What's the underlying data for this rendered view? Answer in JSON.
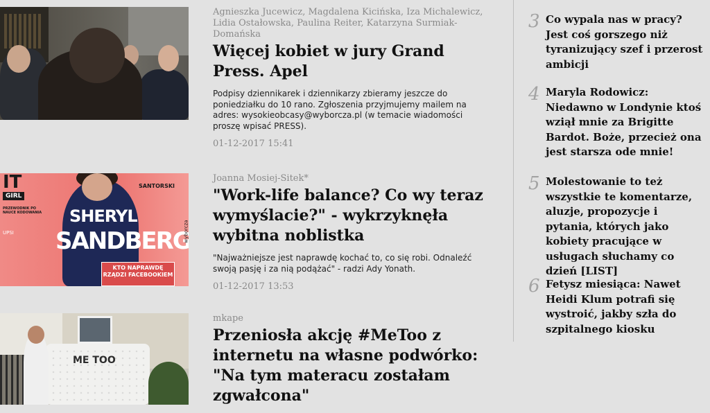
{
  "articles": [
    {
      "authors": "Agnieszka Jucewicz, Magdalena Kicińska, Iza Michalewicz, Lidia Ostałowska, Paulina Reiter, Katarzyna Surmiak-Domańska",
      "title": "Więcej kobiet w jury Grand Press. Apel",
      "lead": "Podpisy dziennikarek i dziennikarzy zbieramy jeszcze do poniedziałku do 10 rano. Zgłoszenia przyjmujemy mailem na adres: wysokieobcasy@wyborcza.pl (w temacie wiadomości proszę wpisać PRESS).",
      "date": "01-12-2017 15:41"
    },
    {
      "authors": "Joanna Mosiej-Sitek*",
      "title": "\"Work-life balance? Co wy teraz wymyślacie?\" - wykrzyknęła wybitna noblistka",
      "lead": "\"Najważniejsze jest naprawdę kochać to, co się robi. Odnaleźć swoją pasję i za nią podążać\" - radzi Ady Yonath.",
      "date": "01-12-2017 13:53"
    },
    {
      "authors": "mkape",
      "title": "Przeniosła akcję #MeToo z internetu na własne podwórko: \"Na tym materacu zostałam zgwałcona\"",
      "lead": "",
      "date": ""
    }
  ],
  "thumbnails": {
    "cover": {
      "it": "IT",
      "girl": "GIRL",
      "guide": "PRZEWODNIK PO NAUCE KODOWANIA",
      "upsi": "UPSI",
      "name_first": "SHERYL",
      "name_last": "SANDBERG",
      "santorski": "SANTORSKI",
      "kto": "KTO NAPRAWDĘ RZĄDZI FACEBOOKIEM",
      "brand": "wyborcza"
    },
    "mattress_text": "ME TOO"
  },
  "ranking": [
    {
      "num": "3",
      "title": "Co wypala nas w pracy? Jest coś gorszego niż tyranizujący szef i przerost ambicji"
    },
    {
      "num": "4",
      "title": "Maryla Rodowicz: Niedawno w Londynie ktoś wziął mnie za Brigitte Bardot. Boże, przecież ona jest starsza ode mnie!"
    },
    {
      "num": "5",
      "title": "Molestowanie to też wszystkie te komentarze, aluzje, propozycje i pytania, których jako kobiety pracujące w usługach słuchamy co dzień [LIST]"
    },
    {
      "num": "6",
      "title": "Fetysz miesiąca: Nawet Heidi Klum potrafi się wystroić, jakby szła do szpitalnego kiosku"
    }
  ]
}
